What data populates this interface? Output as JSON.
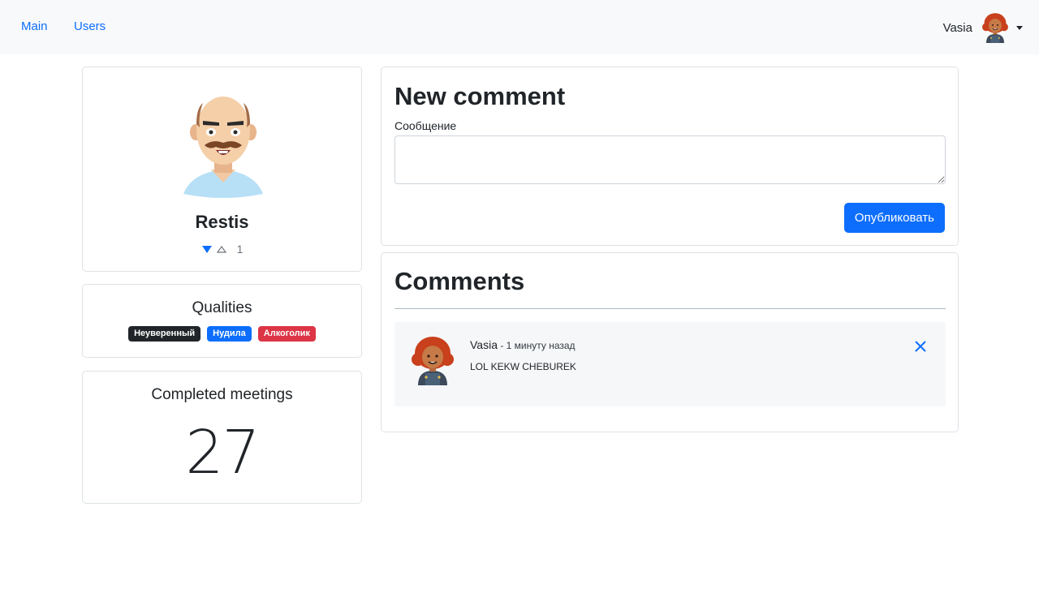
{
  "navbar": {
    "links": [
      {
        "label": "Main"
      },
      {
        "label": "Users"
      }
    ],
    "user": {
      "name": "Vasia",
      "avatar": "avatar-girl-icon"
    }
  },
  "profile": {
    "avatar": "avatar-mustache-man-icon",
    "name": "Restis",
    "rating": {
      "down_icon": "triangle-down-filled-icon",
      "up_icon": "triangle-up-outline-icon",
      "value": "1"
    }
  },
  "qualities": {
    "title": "Qualities",
    "badges": [
      {
        "label": "Неуверенный",
        "color": "#212529"
      },
      {
        "label": "Нудила",
        "color": "#0d6efd"
      },
      {
        "label": "Алкоголик",
        "color": "#dc3545"
      }
    ]
  },
  "meetings": {
    "title": "Completed meetings",
    "count": "27"
  },
  "new_comment": {
    "title": "New comment",
    "field_label": "Сообщение",
    "value": "",
    "submit_label": "Опубликовать"
  },
  "comments": {
    "title": "Comments",
    "items": [
      {
        "author": "Vasia",
        "time": " - 1 минуту назад",
        "text": "LOL KEKW CHEBUREK",
        "avatar": "avatar-girl-icon",
        "delete_icon": "close-icon"
      }
    ]
  },
  "colors": {
    "accent": "#0d6efd",
    "navbar_bg": "#f8f9fa",
    "danger": "#dc3545",
    "dark": "#212529"
  }
}
